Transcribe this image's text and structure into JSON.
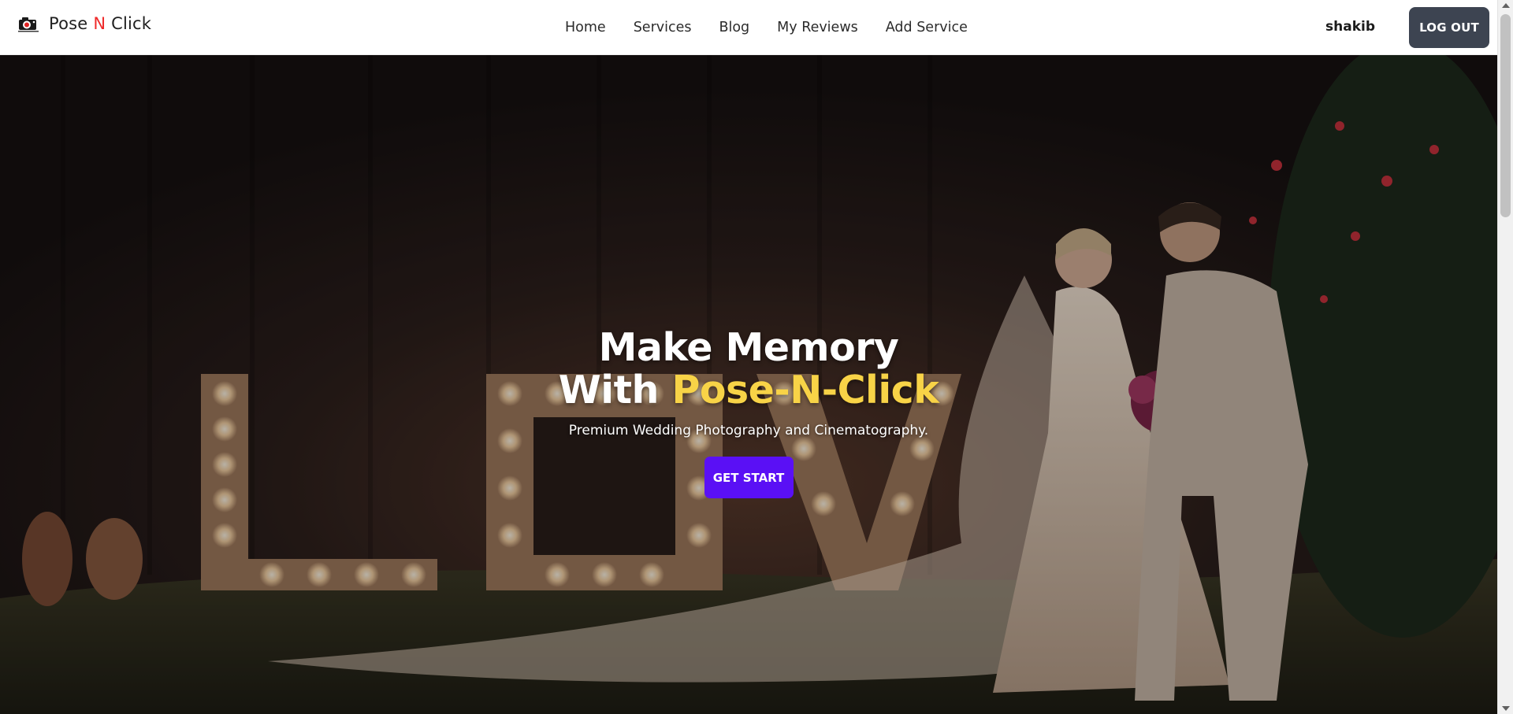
{
  "navbar": {
    "brand": {
      "part1": "Pose ",
      "accent": "N",
      "part2": " Click",
      "accent_color": "#ef2b2b"
    },
    "links": [
      {
        "label": "Home"
      },
      {
        "label": "Services"
      },
      {
        "label": "Blog"
      },
      {
        "label": "My Reviews"
      },
      {
        "label": "Add Service"
      }
    ],
    "user_name": "shakib",
    "logout_label": "LOG OUT"
  },
  "hero": {
    "title_line1": "Make Memory",
    "title_line2_prefix": "With ",
    "title_line2_highlight": "Pose-N-Click",
    "subtitle": "Premium Wedding Photography and Cinematography.",
    "cta_label": "GET START",
    "highlight_color": "#f8d347",
    "cta_color": "#5a10f5",
    "background_description_icon": "wedding-photo-background"
  },
  "icons": {
    "brand_logo": "camera-logo-icon"
  }
}
